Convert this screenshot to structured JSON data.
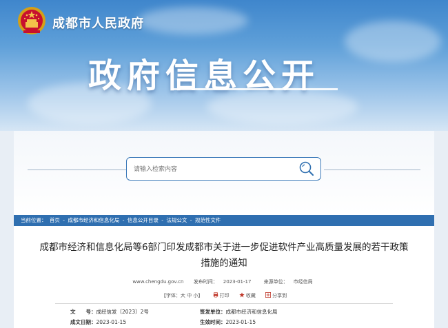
{
  "header": {
    "site_name": "成都市人民政府",
    "banner_title": "政府信息公开"
  },
  "search": {
    "placeholder": "请输入检索内容"
  },
  "breadcrumb": {
    "prefix": "当前位置：",
    "items": [
      "首页",
      "成都市经济和信息化局",
      "信息公开目录",
      "法规公文",
      "规范性文件"
    ],
    "separator": " - "
  },
  "article": {
    "title_line1": "成都市经济和信息化局等6部门印发成都市关于进一步促进软件产业高质量发展的若干政策",
    "title_line2": "措施的通知",
    "site": "www.chengdu.gov.cn",
    "publish_label": "发布时间：",
    "publish_date": "2023-01-17",
    "source_label": "来源单位：",
    "source": "市经信局"
  },
  "tools": {
    "font_label": "【字体：大 中 小】",
    "print": "打印",
    "favorite": "收藏",
    "share": "分享到"
  },
  "info": {
    "doc_no_label": "文　　号：",
    "doc_no": "成经信发〔2023〕2号",
    "issuer_label": "签发单位：",
    "issuer": "成都市经济和信息化局",
    "date_label": "成文日期：",
    "date": "2023-01-15",
    "effective_label": "生效时间：",
    "effective": "2023-01-15"
  }
}
